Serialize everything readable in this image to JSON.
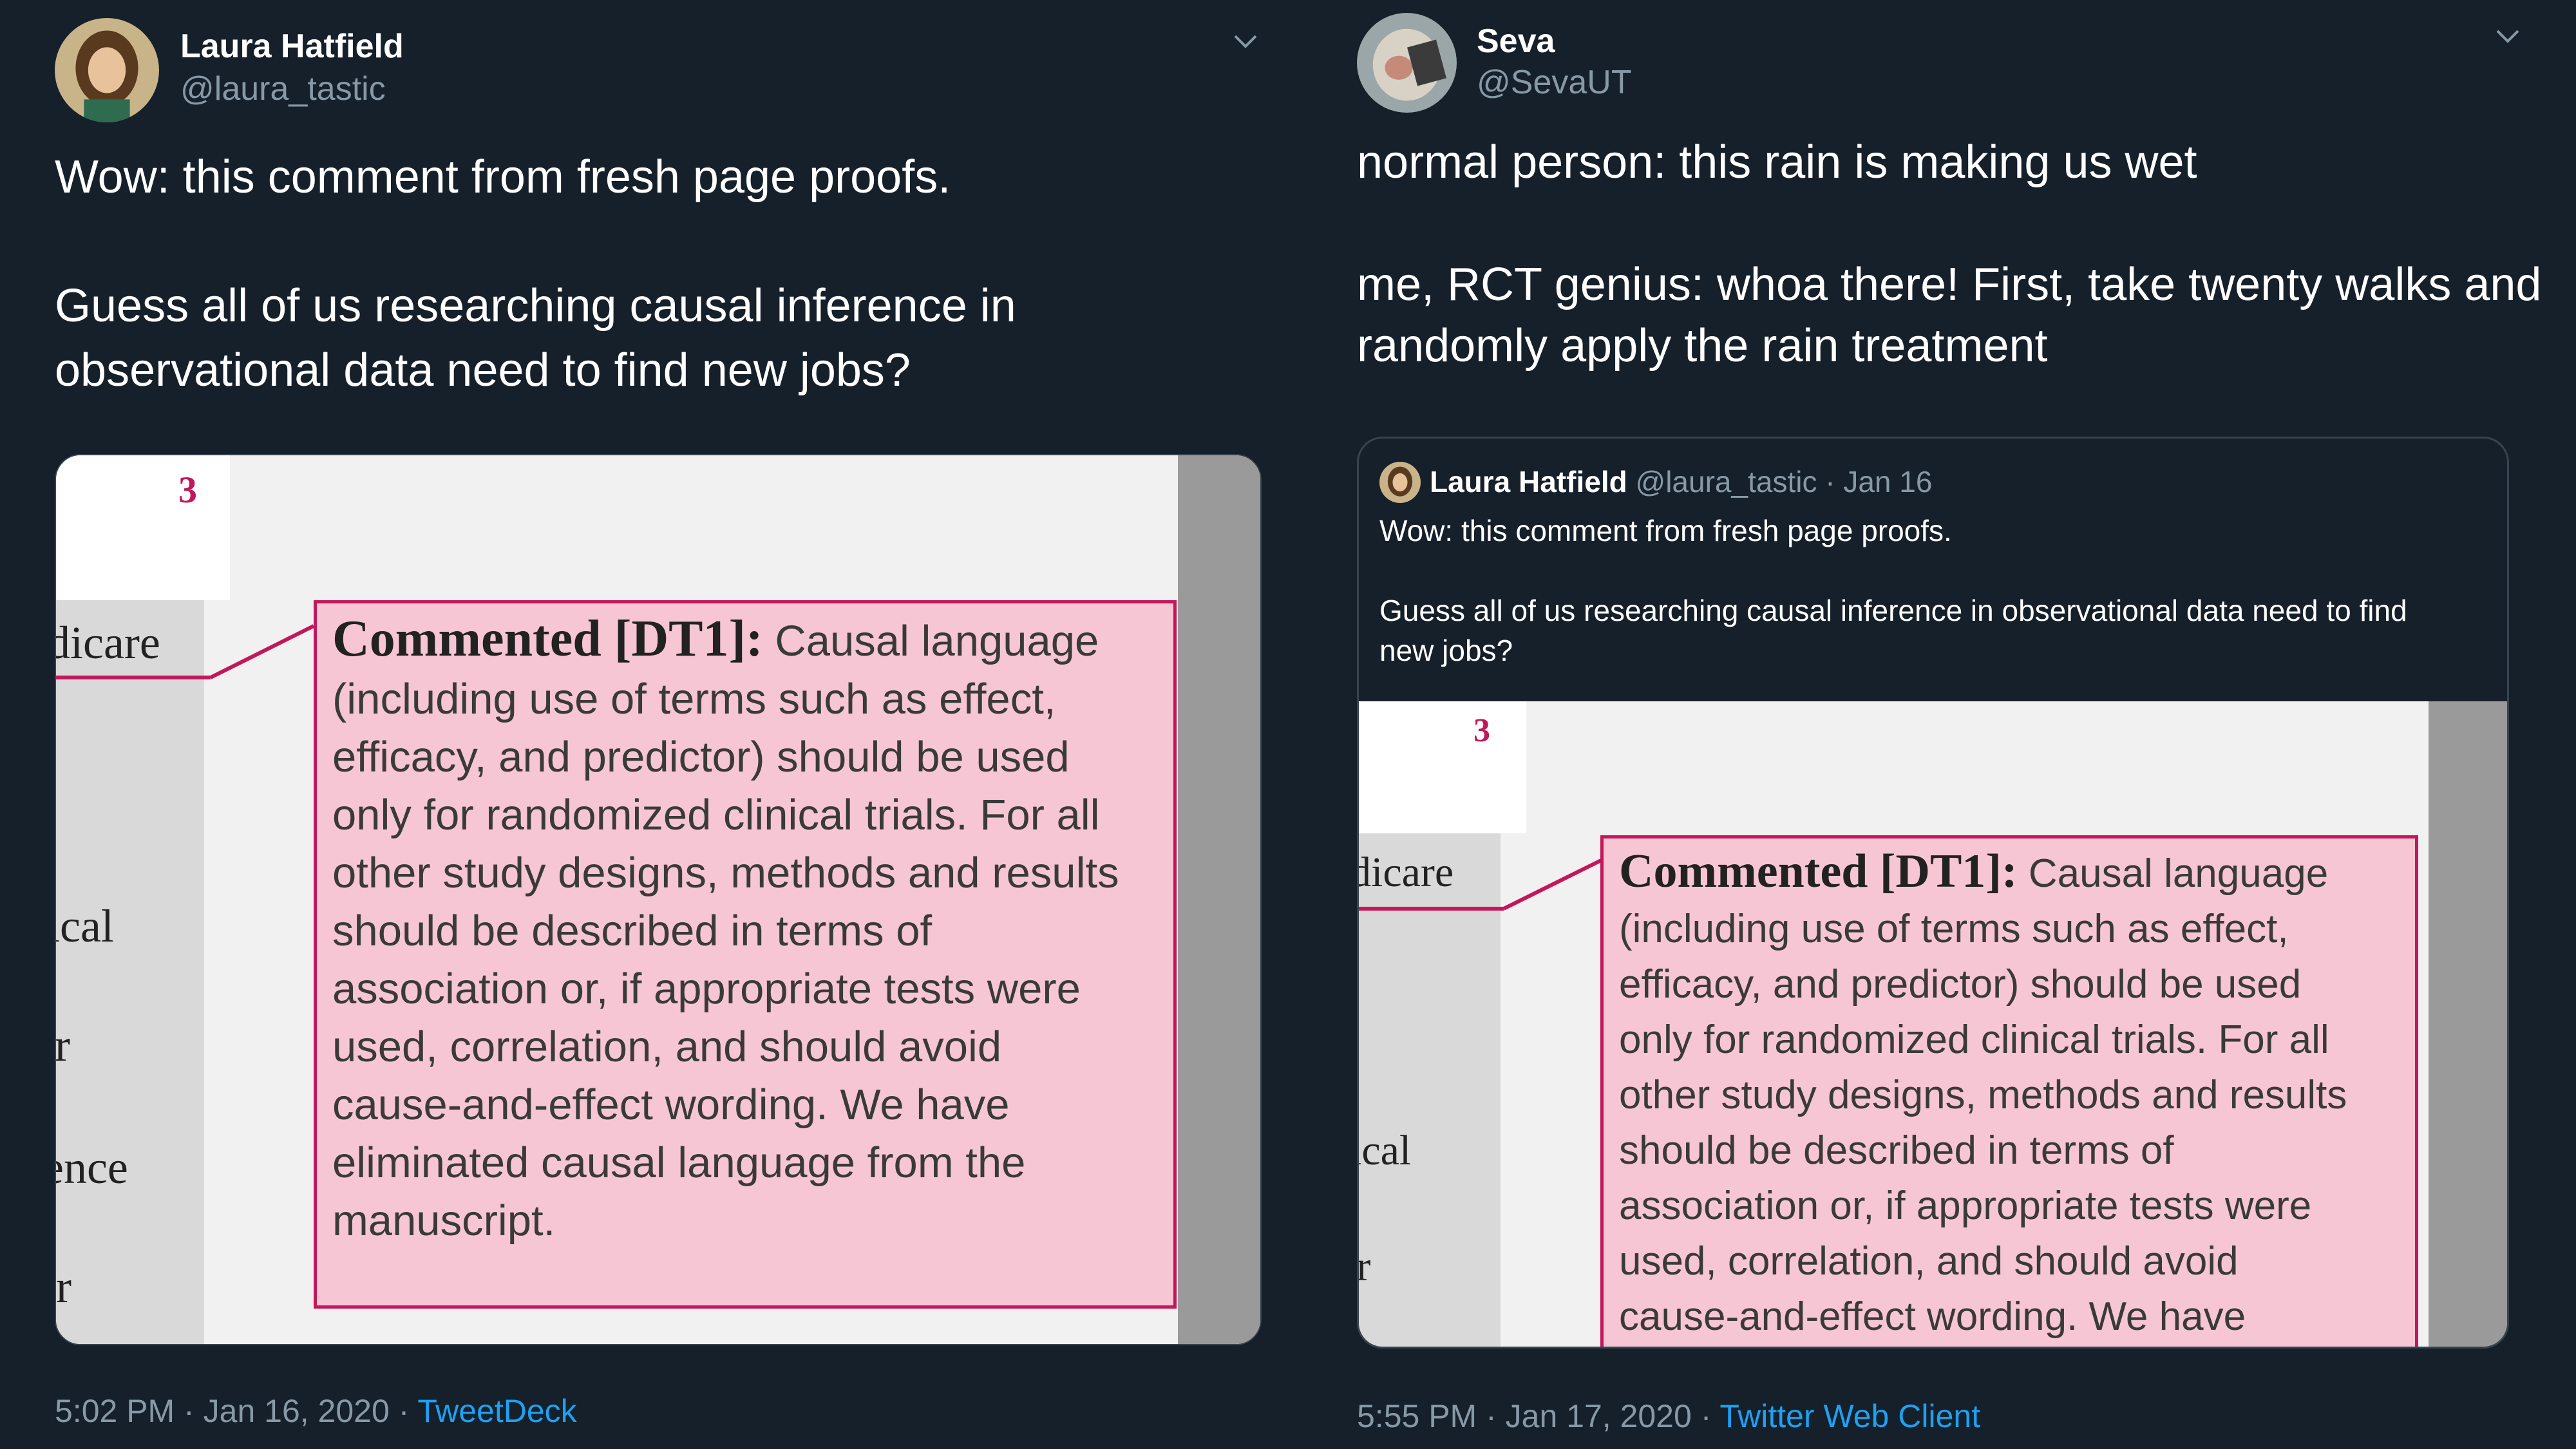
{
  "tweet1": {
    "author_name": "Laura Hatfield",
    "author_handle": "@laura_tastic",
    "text_line1": "Wow: this comment from fresh page proofs.",
    "text_line2": "Guess all of us researching causal inference in",
    "text_line3": "observational data need to find new jobs?",
    "time": "5:02 PM",
    "sep1": " · ",
    "date": "Jan 16, 2020",
    "sep2": " · ",
    "source": "TweetDeck"
  },
  "tweet2": {
    "author_name": "Seva",
    "author_handle": "@SevaUT",
    "text_line1": "normal person: this rain is making us wet",
    "text_line2": "me, RCT genius: whoa there! First, take twenty walks and",
    "text_line3": "randomly apply the rain treatment",
    "time": "5:55 PM",
    "sep1": " · ",
    "date": "Jan 17, 2020",
    "sep2": " · ",
    "source": "Twitter Web Client",
    "quote": {
      "author_name": "Laura Hatfield",
      "author_handle": "@laura_tastic",
      "dot": " · ",
      "date": "Jan 16",
      "text_line1": "Wow: this comment from fresh page proofs.",
      "text_line2": "Guess all of us researching causal inference in observational data need to find",
      "text_line3": "new jobs?"
    }
  },
  "doc_image": {
    "page_number": "3",
    "side_words": [
      "dicare",
      "ical",
      "ir",
      "ence",
      "er"
    ],
    "comment_title": "Commented [DT1]:",
    "comment_lines": [
      "Causal language",
      "(including use of terms such as effect,",
      "efficacy, and predictor) should be used",
      "only for randomized clinical trials. For all",
      "other study designs, methods and results",
      "should be described in terms of",
      "association or, if appropriate tests were",
      "used, correlation, and should avoid",
      "cause-and-effect wording. We have",
      "eliminated causal language from the",
      "manuscript."
    ]
  },
  "icons": {
    "caret": "chevron-down-icon"
  },
  "colors": {
    "background": "#15202b",
    "secondary_text": "#8899a6",
    "link": "#1da1f2",
    "comment_fill": "#f7c6d4",
    "comment_border": "#c2185b"
  }
}
